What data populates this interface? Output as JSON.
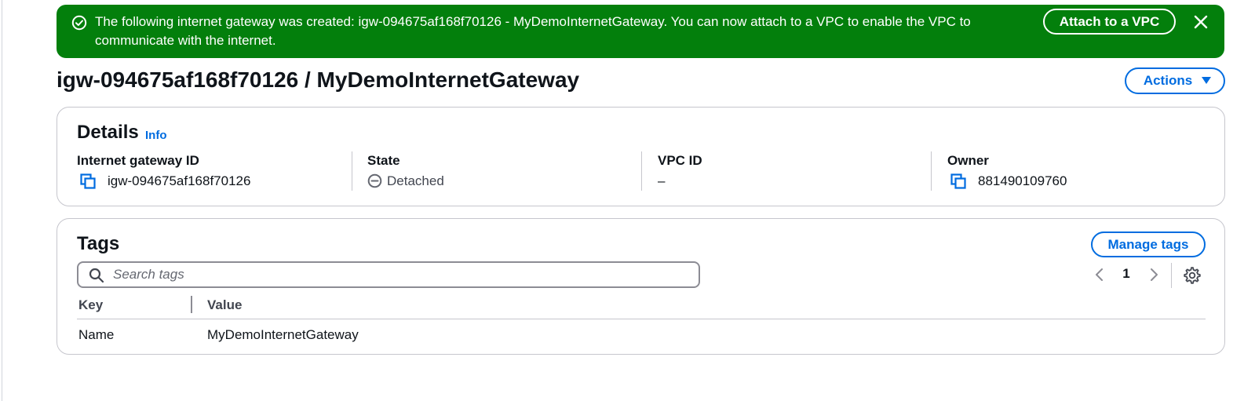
{
  "flash": {
    "message": "The following internet gateway was created: igw-094675af168f70126 - MyDemoInternetGateway. You can now attach to a VPC to enable the VPC to communicate with the internet.",
    "action_label": "Attach to a VPC",
    "status": "success",
    "background_color": "#037f0c",
    "status_icon": "check-circle-icon",
    "close_icon": "close-icon"
  },
  "header": {
    "title": "igw-094675af168f70126 / MyDemoInternetGateway",
    "actions_label": "Actions",
    "actions_icon": "caret-down-icon"
  },
  "details": {
    "heading": "Details",
    "info_label": "Info",
    "fields": [
      {
        "label": "Internet gateway ID",
        "value": "igw-094675af168f70126",
        "icon": "copy-icon"
      },
      {
        "label": "State",
        "value": "Detached",
        "icon": "status-stopped-icon"
      },
      {
        "label": "VPC ID",
        "value": "–"
      },
      {
        "label": "Owner",
        "value": "881490109760",
        "icon": "copy-icon"
      }
    ]
  },
  "tags": {
    "heading": "Tags",
    "manage_label": "Manage tags",
    "search_placeholder": "Search tags",
    "search_value": "",
    "current_page": "1",
    "columns": [
      "Key",
      "Value"
    ],
    "rows": [
      {
        "key": "Name",
        "value": "MyDemoInternetGateway"
      }
    ]
  },
  "colors": {
    "link": "#006ce0",
    "success": "#037f0c",
    "text": "#0f141a",
    "border": "#c6c6cd"
  }
}
